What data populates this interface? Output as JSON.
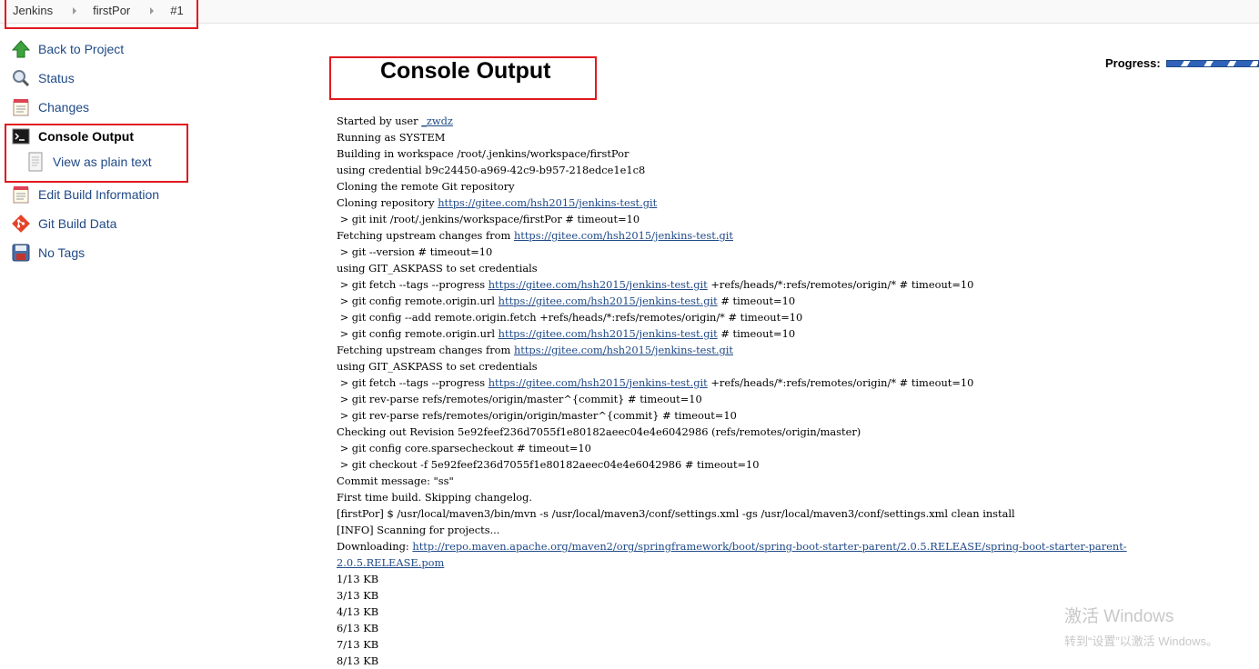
{
  "breadcrumb": {
    "items": [
      "Jenkins",
      "firstPor",
      "#1"
    ]
  },
  "sidebar": {
    "items": [
      {
        "label": "Back to Project",
        "icon": "up-arrow-icon"
      },
      {
        "label": "Status",
        "icon": "magnifier-icon"
      },
      {
        "label": "Changes",
        "icon": "notepad-icon"
      },
      {
        "label": "Console Output",
        "icon": "terminal-icon",
        "active": true
      },
      {
        "label": "View as plain text",
        "icon": "document-icon"
      },
      {
        "label": "Edit Build Information",
        "icon": "notepad-icon"
      },
      {
        "label": "Git Build Data",
        "icon": "git-icon"
      },
      {
        "label": "No Tags",
        "icon": "save-icon"
      }
    ]
  },
  "main": {
    "title": "Console Output",
    "progress_label": "Progress:"
  },
  "console": {
    "lines": [
      [
        {
          "t": "Started by user "
        },
        {
          "t": "_zwdz",
          "link": true
        }
      ],
      [
        {
          "t": "Running as SYSTEM"
        }
      ],
      [
        {
          "t": "Building in workspace /root/.jenkins/workspace/firstPor"
        }
      ],
      [
        {
          "t": "using credential b9c24450-a969-42c9-b957-218edce1e1c8"
        }
      ],
      [
        {
          "t": "Cloning the remote Git repository"
        }
      ],
      [
        {
          "t": "Cloning repository "
        },
        {
          "t": "https://gitee.com/hsh2015/jenkins-test.git",
          "link": true
        }
      ],
      [
        {
          "t": " > git init /root/.jenkins/workspace/firstPor # timeout=10"
        }
      ],
      [
        {
          "t": "Fetching upstream changes from "
        },
        {
          "t": "https://gitee.com/hsh2015/jenkins-test.git",
          "link": true
        }
      ],
      [
        {
          "t": " > git --version # timeout=10"
        }
      ],
      [
        {
          "t": "using GIT_ASKPASS to set credentials"
        }
      ],
      [
        {
          "t": " > git fetch --tags --progress "
        },
        {
          "t": "https://gitee.com/hsh2015/jenkins-test.git",
          "link": true
        },
        {
          "t": " +refs/heads/*:refs/remotes/origin/* # timeout=10"
        }
      ],
      [
        {
          "t": " > git config remote.origin.url "
        },
        {
          "t": "https://gitee.com/hsh2015/jenkins-test.git",
          "link": true
        },
        {
          "t": " # timeout=10"
        }
      ],
      [
        {
          "t": " > git config --add remote.origin.fetch +refs/heads/*:refs/remotes/origin/* # timeout=10"
        }
      ],
      [
        {
          "t": " > git config remote.origin.url "
        },
        {
          "t": "https://gitee.com/hsh2015/jenkins-test.git",
          "link": true
        },
        {
          "t": " # timeout=10"
        }
      ],
      [
        {
          "t": "Fetching upstream changes from "
        },
        {
          "t": "https://gitee.com/hsh2015/jenkins-test.git",
          "link": true
        }
      ],
      [
        {
          "t": "using GIT_ASKPASS to set credentials"
        }
      ],
      [
        {
          "t": " > git fetch --tags --progress "
        },
        {
          "t": "https://gitee.com/hsh2015/jenkins-test.git",
          "link": true
        },
        {
          "t": " +refs/heads/*:refs/remotes/origin/* # timeout=10"
        }
      ],
      [
        {
          "t": " > git rev-parse refs/remotes/origin/master^{commit} # timeout=10"
        }
      ],
      [
        {
          "t": " > git rev-parse refs/remotes/origin/origin/master^{commit} # timeout=10"
        }
      ],
      [
        {
          "t": "Checking out Revision 5e92feef236d7055f1e80182aeec04e4e6042986 (refs/remotes/origin/master)"
        }
      ],
      [
        {
          "t": " > git config core.sparsecheckout # timeout=10"
        }
      ],
      [
        {
          "t": " > git checkout -f 5e92feef236d7055f1e80182aeec04e4e6042986 # timeout=10"
        }
      ],
      [
        {
          "t": "Commit message: \"ss\""
        }
      ],
      [
        {
          "t": "First time build. Skipping changelog."
        }
      ],
      [
        {
          "t": "[firstPor] $ /usr/local/maven3/bin/mvn -s /usr/local/maven3/conf/settings.xml -gs /usr/local/maven3/conf/settings.xml clean install"
        }
      ],
      [
        {
          "t": "[INFO] Scanning for projects..."
        }
      ],
      [
        {
          "t": "Downloading: "
        },
        {
          "t": "http://repo.maven.apache.org/maven2/org/springframework/boot/spring-boot-starter-parent/2.0.5.RELEASE/spring-boot-starter-parent-2.0.5.RELEASE.pom",
          "link": true
        }
      ],
      [
        {
          "t": "1/13 KB"
        }
      ],
      [
        {
          "t": "3/13 KB"
        }
      ],
      [
        {
          "t": "4/13 KB"
        }
      ],
      [
        {
          "t": "6/13 KB"
        }
      ],
      [
        {
          "t": "7/13 KB"
        }
      ],
      [
        {
          "t": "8/13 KB"
        }
      ]
    ]
  },
  "watermark": {
    "line1": "激活 Windows",
    "line2": "转到“设置”以激活 Windows。"
  }
}
